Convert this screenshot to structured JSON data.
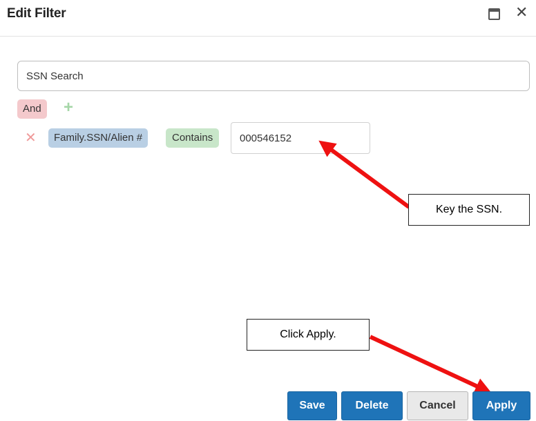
{
  "dialog": {
    "title": "Edit Filter",
    "maximize_icon": "maximize-icon",
    "close_icon": "close-icon",
    "close_glyph": "✕"
  },
  "filter": {
    "name": "SSN Search",
    "group_operator": "And",
    "add_icon": "plus-icon",
    "add_glyph": "+",
    "conditions": [
      {
        "remove_icon": "close-icon",
        "remove_glyph": "✕",
        "field": "Family.SSN/Alien #",
        "operator": "Contains",
        "value": "000546152"
      }
    ]
  },
  "annotations": {
    "ssn_note": "Key the SSN.",
    "apply_note": "Click Apply.",
    "arrow_color": "#ee1111"
  },
  "footer": {
    "save_label": "Save",
    "delete_label": "Delete",
    "cancel_label": "Cancel",
    "apply_label": "Apply"
  },
  "colors": {
    "primary": "#1f74b8",
    "and_chip": "#f4c9cc",
    "field_chip": "#b9cfe4",
    "operator_chip": "#c8e6c9"
  }
}
